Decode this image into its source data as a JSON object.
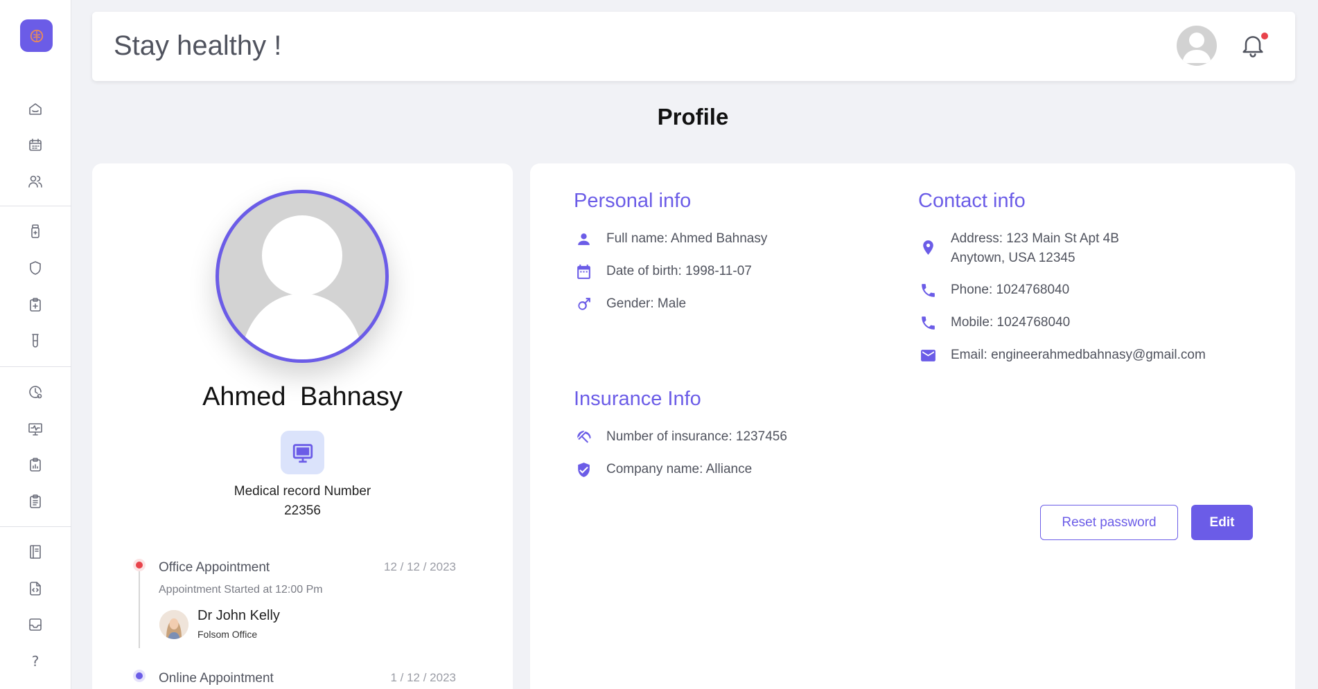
{
  "header": {
    "title": "Stay healthy !"
  },
  "page_title": "Profile",
  "sidebar": {
    "items": [
      {
        "icon": "home-icon"
      },
      {
        "icon": "calendar-icon"
      },
      {
        "icon": "users-icon"
      },
      {
        "icon": "medicine-bottle-icon"
      },
      {
        "icon": "shield-icon"
      },
      {
        "icon": "clipboard-plus-icon"
      },
      {
        "icon": "test-tube-icon"
      },
      {
        "icon": "clock-history-icon"
      },
      {
        "icon": "monitor-pulse-icon"
      },
      {
        "icon": "clipboard-chart-icon"
      },
      {
        "icon": "clipboard-list-icon"
      },
      {
        "icon": "notebook-icon"
      },
      {
        "icon": "file-code-icon"
      },
      {
        "icon": "inbox-icon"
      }
    ],
    "help_label": "?"
  },
  "profile": {
    "name": "Ahmed   Bahnasy",
    "record_label": "Medical record Number",
    "record_number": "22356"
  },
  "appointments": [
    {
      "title": "Office Appointment",
      "date": "12 / 12 / 2023",
      "status_color": "#e8434b",
      "started": "Appointment Started at 12:00 Pm",
      "doctor": "Dr John Kelly",
      "office": "Folsom Office"
    },
    {
      "title": "Online Appointment",
      "date": "1 / 12 / 2023",
      "status_color": "#6b5ce7"
    }
  ],
  "personal_info": {
    "title": "Personal info",
    "full_name": "Full name: Ahmed  Bahnasy",
    "dob": "Date of birth: 1998-11-07",
    "gender": "Gender: Male"
  },
  "contact_info": {
    "title": "Contact info",
    "address_line1": "Address: 123 Main St Apt 4B",
    "address_line2": "Anytown, USA 12345",
    "phone": "Phone: 1024768040",
    "mobile": "Mobile: 1024768040",
    "email": "Email: engineerahmedbahnasy@gmail.com"
  },
  "insurance_info": {
    "title": "Insurance Info",
    "number": "Number of insurance: 1237456",
    "company": "Company name: Alliance"
  },
  "buttons": {
    "reset_password": "Reset password",
    "edit": "Edit"
  },
  "colors": {
    "accent": "#6b5ce7",
    "notification_dot": "#e8434b",
    "background": "#f1f2f6"
  }
}
